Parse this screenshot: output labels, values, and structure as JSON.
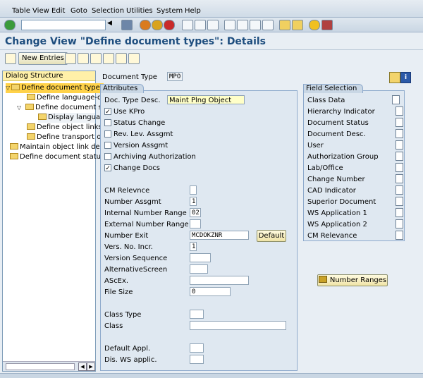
{
  "menu": [
    "Table View",
    "Edit",
    "Goto",
    "Selection",
    "Utilities",
    "System",
    "Help"
  ],
  "title": "Change View \"Define document types\": Details",
  "app_toolbar": {
    "new_entries": "New Entries"
  },
  "tree": {
    "header": "Dialog Structure",
    "items": [
      {
        "label": "Define document types",
        "level": 0,
        "expanded": true,
        "selected": true
      },
      {
        "label": "Define language-d",
        "level": 1
      },
      {
        "label": "Define document s",
        "level": 1,
        "expanded": true
      },
      {
        "label": "Display langua",
        "level": 2
      },
      {
        "label": "Define object links",
        "level": 1
      },
      {
        "label": "Define transport of c",
        "level": 1
      },
      {
        "label": "Maintain object link des",
        "level": 0
      },
      {
        "label": "Define document status",
        "level": 0
      }
    ]
  },
  "doc_type": {
    "label": "Document Type",
    "value": "MPO"
  },
  "attributes": {
    "tab": "Attributes",
    "doc_type_desc_label": "Doc. Type Desc.",
    "doc_type_desc_value": "Maint Plng Object",
    "checkboxes": [
      {
        "label": "Use KPro",
        "checked": true
      },
      {
        "label": "Status Change",
        "checked": false
      },
      {
        "label": "Rev. Lev. Assgmt",
        "checked": false
      },
      {
        "label": "Version Assgmt",
        "checked": false
      },
      {
        "label": "Archiving Authorization",
        "checked": false
      },
      {
        "label": "Change Docs",
        "checked": true
      }
    ],
    "fields": [
      {
        "label": "CM Relevnce",
        "value": ""
      },
      {
        "label": "Number Assgmt",
        "value": "1"
      },
      {
        "label": "Internal Number Range",
        "value": "02"
      },
      {
        "label": "External Number Range",
        "value": ""
      },
      {
        "label": "Number Exit",
        "value": "MCDOKZNR"
      },
      {
        "label": "Vers. No. Incr.",
        "value": "1"
      },
      {
        "label": "Version Sequence",
        "value": ""
      },
      {
        "label": "AlternativeScreen",
        "value": ""
      },
      {
        "label": "AScEx.",
        "value": ""
      },
      {
        "label": "File Size",
        "value": "0"
      },
      {
        "label": "Class Type",
        "value": ""
      },
      {
        "label": "Class",
        "value": ""
      },
      {
        "label": "Default Appl.",
        "value": ""
      },
      {
        "label": "Dis. WS applic.",
        "value": ""
      }
    ],
    "default_button": "Default"
  },
  "field_selection": {
    "tab": "Field Selection",
    "items": [
      "Class Data",
      "Hierarchy Indicator",
      "Document Status",
      "Document Desc.",
      "User",
      "Authorization Group",
      "Lab/Office",
      "Change Number",
      "CAD Indicator",
      "Superior Document",
      "WS Application 1",
      "WS Application 2",
      "CM Relevance"
    ]
  },
  "number_ranges_button": "Number Ranges"
}
